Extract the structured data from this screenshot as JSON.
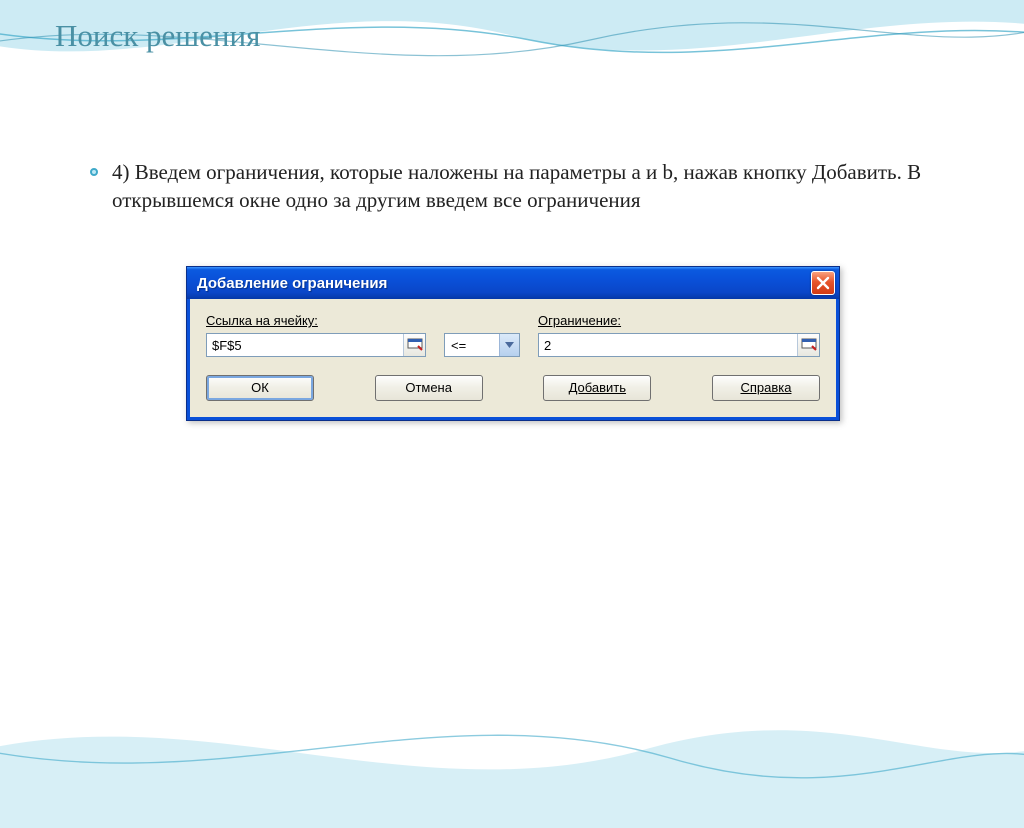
{
  "slide": {
    "title": "Поиск решения",
    "bullet_text": "4) Введем ограничения, которые наложены на параметры a и b, нажав кнопку Добавить. В открывшемся окне одно за другим введем все ограничения"
  },
  "dialog": {
    "title": "Добавление ограничения",
    "labels": {
      "cell_ref": "Ссылка на ячейку:",
      "constraint": "Ограничение:"
    },
    "fields": {
      "cell_ref_value": "$F$5",
      "operator_value": "<=",
      "constraint_value": "2"
    },
    "buttons": {
      "ok": "ОК",
      "cancel": "Отмена",
      "add": "Добавить",
      "help": "Справка"
    }
  }
}
